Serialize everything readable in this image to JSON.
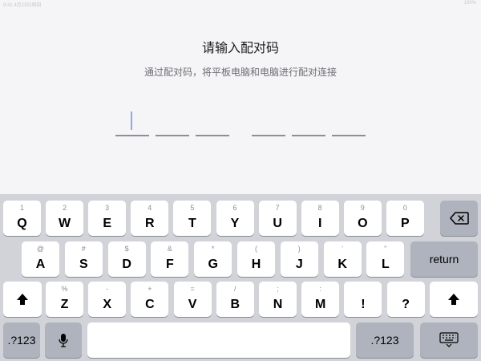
{
  "status_bar": {
    "left": "9:41  4月23日周四",
    "right": "100%"
  },
  "pairing": {
    "title": "请输入配对码",
    "subtitle": "通过配对码，将平板电脑和电脑进行配对连接"
  },
  "keyboard": {
    "row1": [
      {
        "hint": "1",
        "char": "Q"
      },
      {
        "hint": "2",
        "char": "W"
      },
      {
        "hint": "3",
        "char": "E"
      },
      {
        "hint": "4",
        "char": "R"
      },
      {
        "hint": "5",
        "char": "T"
      },
      {
        "hint": "6",
        "char": "Y"
      },
      {
        "hint": "7",
        "char": "U"
      },
      {
        "hint": "8",
        "char": "I"
      },
      {
        "hint": "9",
        "char": "O"
      },
      {
        "hint": "0",
        "char": "P"
      }
    ],
    "row2": [
      {
        "hint": "@",
        "char": "A"
      },
      {
        "hint": "#",
        "char": "S"
      },
      {
        "hint": "$",
        "char": "D"
      },
      {
        "hint": "&",
        "char": "F"
      },
      {
        "hint": "*",
        "char": "G"
      },
      {
        "hint": "(",
        "char": "H"
      },
      {
        "hint": ")",
        "char": "J"
      },
      {
        "hint": "'",
        "char": "K"
      },
      {
        "hint": "\"",
        "char": "L"
      }
    ],
    "row3": [
      {
        "hint": "%",
        "char": "Z"
      },
      {
        "hint": "-",
        "char": "X"
      },
      {
        "hint": "+",
        "char": "C"
      },
      {
        "hint": "=",
        "char": "V"
      },
      {
        "hint": "/",
        "char": "B"
      },
      {
        "hint": ";",
        "char": "N"
      },
      {
        "hint": ":",
        "char": "M"
      },
      {
        "hint": "",
        "char": "!"
      },
      {
        "hint": "",
        "char": "?"
      }
    ],
    "return_label": "return",
    "numbers_label": ".?123",
    "icons": {
      "backspace": "backspace-icon",
      "shift": "shift-icon",
      "mic": "microphone-icon",
      "hide": "keyboard-hide-icon"
    }
  }
}
